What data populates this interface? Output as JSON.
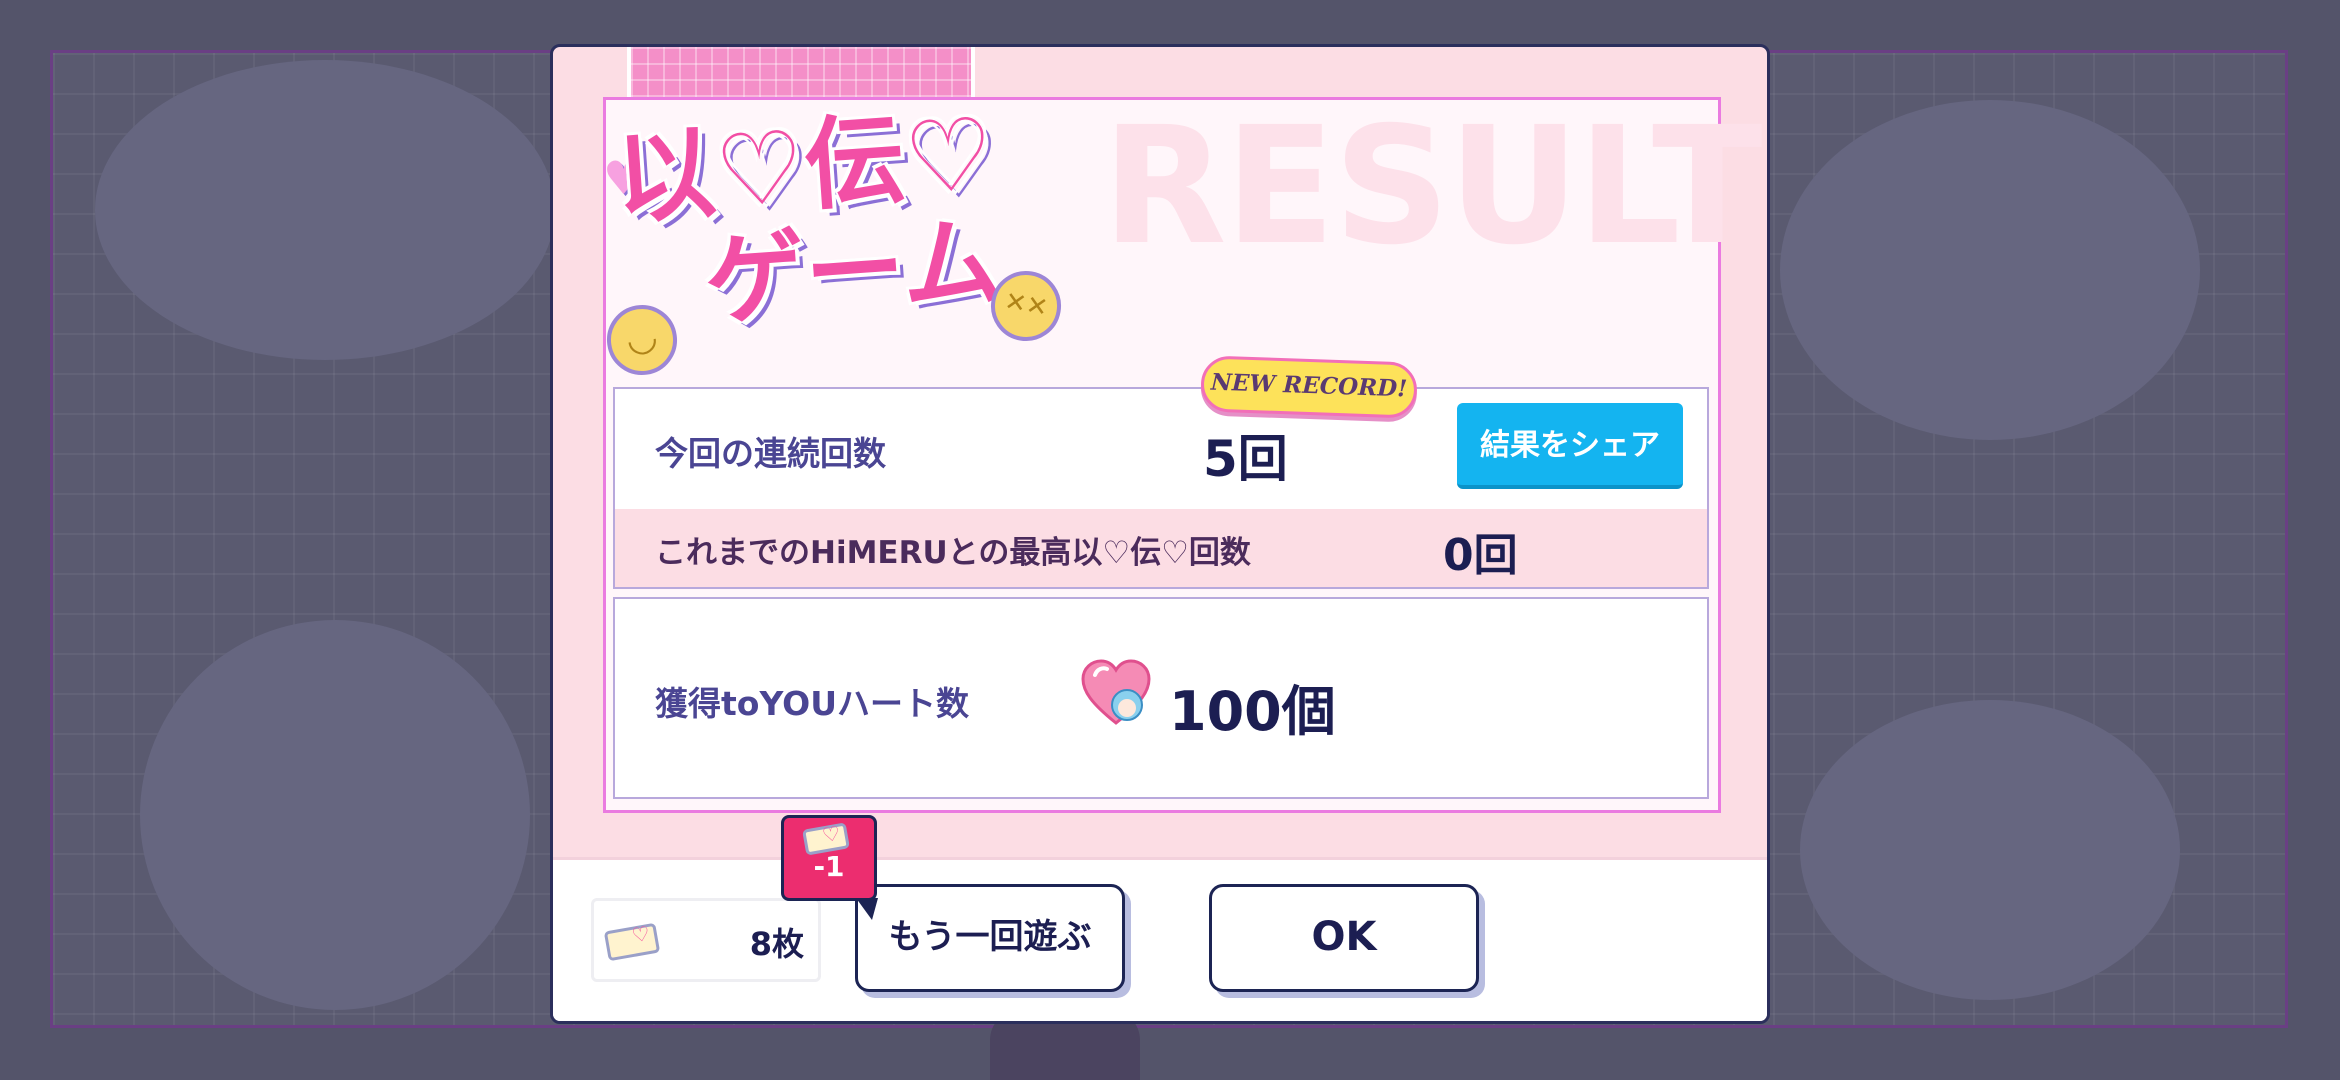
{
  "background": {
    "frame_border_color": "#6a3f84",
    "dim_color": "#54546a"
  },
  "modal": {
    "watermark": "RESULT",
    "logo": {
      "line1": "以♡伝♡",
      "line2": "ゲーム",
      "left_icon": "smiley-face-icon",
      "right_icon": "dizzy-face-icon",
      "heart_icon": "heart-icon"
    },
    "badge": "NEW RECORD!",
    "current_streak": {
      "label": "今回の連続回数",
      "value": "5回"
    },
    "share_button": "結果をシェア",
    "best_record": {
      "label": "これまでのHiMERUとの最高以♡伝♡回数",
      "value": "0回"
    },
    "hearts": {
      "label": "獲得toYOUハート数",
      "icon": "heart-character-icon",
      "value": "100個"
    }
  },
  "footer": {
    "tickets": {
      "icon": "ticket-icon",
      "count": "8枚"
    },
    "cost_tag": {
      "icon": "ticket-icon",
      "value": "-1"
    },
    "play_again_button": "もう一回遊ぶ",
    "ok_button": "OK"
  },
  "colors": {
    "accent_pink": "#f24fa5",
    "share_blue": "#14b4f0",
    "navy_text": "#1c1e52",
    "cost_red": "#ec2d6f",
    "badge_yellow": "#fde25a"
  }
}
